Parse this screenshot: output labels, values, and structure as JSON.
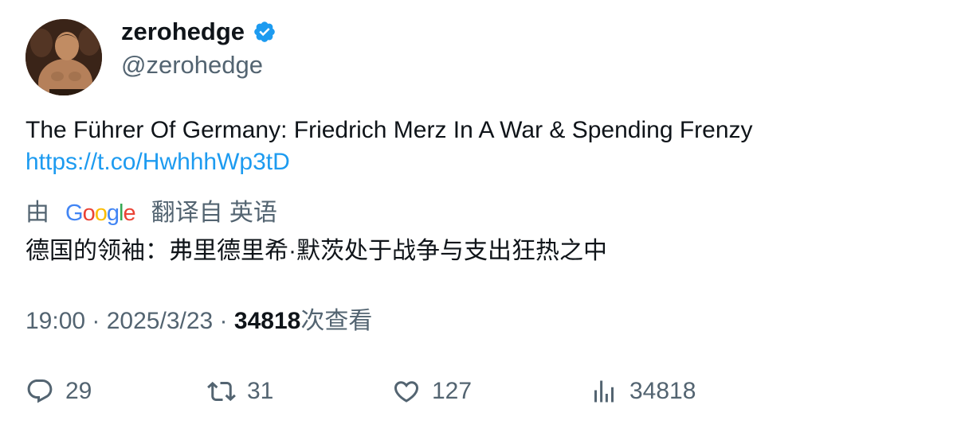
{
  "author": {
    "display_name": "zerohedge",
    "handle": "@zerohedge",
    "verified": true,
    "avatar_icon": "avatar-photo"
  },
  "tweet": {
    "text": "The Führer Of Germany: Friedrich Merz In A War & Spending Frenzy",
    "link": "https://t.co/HwhhhWp3tD"
  },
  "translation": {
    "prefix": "由",
    "provider": "Google",
    "suffix": "翻译自 英语",
    "text": "德国的领袖：弗里德里希·默茨处于战争与支出狂热之中"
  },
  "meta": {
    "time": "19:00",
    "separator": " · ",
    "date": "2025/3/23",
    "views_count": "34818",
    "views_label": "次查看"
  },
  "actions": {
    "replies": "29",
    "retweets": "31",
    "likes": "127",
    "views": "34818"
  },
  "colors": {
    "link": "#1d9bf0",
    "secondary_text": "#536471",
    "verified_badge": "#1d9bf0"
  }
}
